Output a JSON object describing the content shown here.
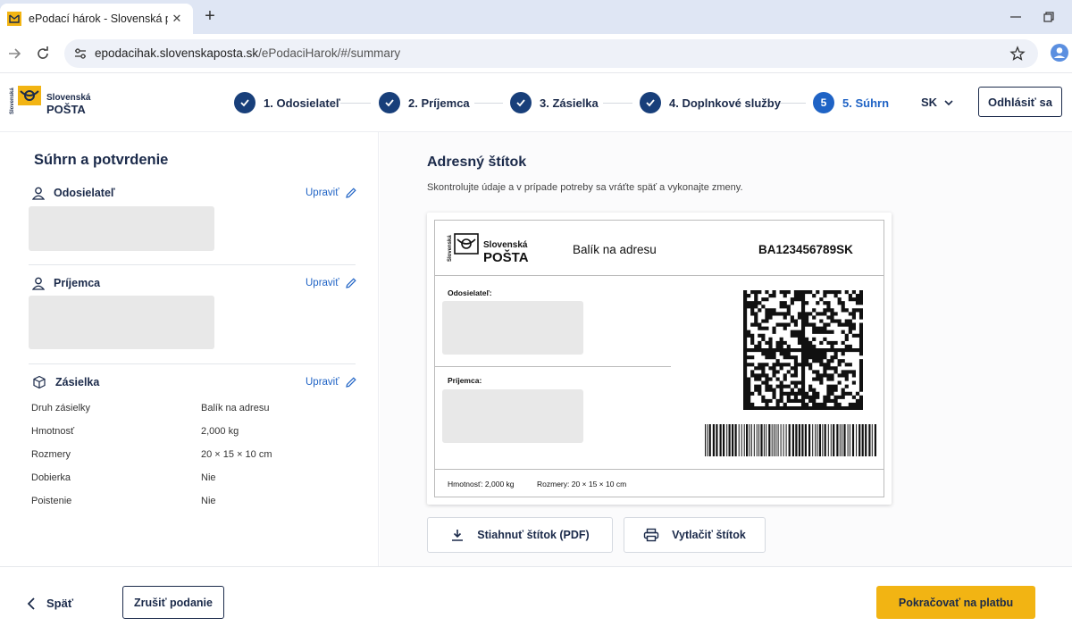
{
  "browser": {
    "tab_title": "ePodací hárok - Slovenská pošta",
    "url_host": "epodacihak.slovenskaposta.sk",
    "url_path": "/ePodaciHarok/#/summary"
  },
  "brand": {
    "line1": "Slovenská",
    "line2": "POŠTA",
    "vertical": "Slovenská"
  },
  "steps": [
    {
      "number": "1",
      "label": "1. Odosielateľ",
      "state": "done"
    },
    {
      "number": "2",
      "label": "2. Príjemca",
      "state": "done"
    },
    {
      "number": "3",
      "label": "3. Zásielka",
      "state": "done"
    },
    {
      "number": "4",
      "label": "4. Doplnkové služby",
      "state": "done"
    },
    {
      "number": "5",
      "label": "5. Súhrn",
      "state": "active"
    }
  ],
  "header": {
    "lang": "SK",
    "logout": "Odhlásiť sa"
  },
  "summary": {
    "title": "Súhrn a potvrdenie",
    "edit_label": "Upraviť",
    "sender_title": "Odosielateľ",
    "recipient_title": "Príjemca",
    "shipment_title": "Zásielka",
    "rows": [
      {
        "key": "Druh zásielky",
        "value": "Balík na adresu"
      },
      {
        "key": "Hmotnosť",
        "value": "2,000 kg"
      },
      {
        "key": "Rozmery",
        "value": "20 × 15 × 10 cm"
      },
      {
        "key": "Dobierka",
        "value": "Nie"
      },
      {
        "key": "Poistenie",
        "value": "Nie"
      }
    ]
  },
  "label": {
    "title": "Adresný štítok",
    "subtitle": "Skontrolujte údaje a v prípade potreby sa vráťte späť a vykonajte zmeny.",
    "type": "Balík na adresu",
    "code": "BA123456789SK",
    "sender": "Odosielateľ:",
    "recipient": "Príjemca:",
    "weight": "Hmotnosť: 2,000 kg",
    "dims": "Rozmery: 20 × 15 × 10 cm",
    "download": "Stiahnuť štítok (PDF)",
    "print": "Vytlačiť štítok"
  },
  "footer": {
    "back": "Späť",
    "cancel": "Zrušiť podanie",
    "continue": "Pokračovať na platbu"
  },
  "colors": {
    "navy": "#183f7a",
    "accent_blue": "#1f63c5",
    "accent_yellow": "#f2b413"
  }
}
